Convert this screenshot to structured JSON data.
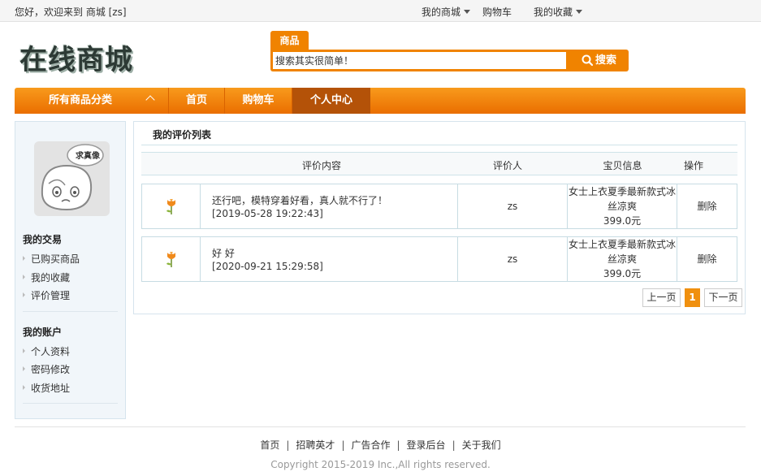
{
  "topbar": {
    "welcome": "您好，欢迎来到 商城 [zs]",
    "my_mall": "我的商城",
    "cart": "购物车",
    "favorites": "我的收藏"
  },
  "header": {
    "logo_text": "在线商城",
    "search_tab": "商品",
    "search_value": "搜索其实很简单！",
    "search_button": "搜索"
  },
  "nav": {
    "all_categories": "所有商品分类",
    "items": [
      "首页",
      "购物车",
      "个人中心"
    ],
    "active": "个人中心"
  },
  "sidebar": {
    "avatar_caption": "求真像",
    "section1_title": "我的交易",
    "section1_items": [
      "已购买商品",
      "我的收藏",
      "评价管理"
    ],
    "section2_title": "我的账户",
    "section2_items": [
      "个人资料",
      "密码修改",
      "收货地址"
    ]
  },
  "main": {
    "title": "我的评价列表",
    "columns": [
      "评价内容",
      "评价人",
      "宝贝信息",
      "操作"
    ],
    "rows": [
      {
        "comment": "还行吧，模特穿着好看，真人就不行了！",
        "date": "[2019-05-28 19:22:43]",
        "user": "zs",
        "product": "女士上衣夏季最新款式冰丝凉爽",
        "price": "399.0元",
        "action": "删除"
      },
      {
        "comment": "好 好",
        "date": "[2020-09-21 15:29:58]",
        "user": "zs",
        "product": "女士上衣夏季最新款式冰丝凉爽",
        "price": "399.0元",
        "action": "删除"
      }
    ],
    "pager": {
      "prev": "上一页",
      "current": "1",
      "next": "下一页"
    }
  },
  "footer": {
    "links": [
      "首页",
      "招聘英才",
      "广告合作",
      "登录后台",
      "关于我们"
    ],
    "copyright": "Copyright 2015-2019 Inc.,All rights reserved."
  },
  "colors": {
    "accent": "#f08300",
    "nav_active": "#b45208",
    "sidebar_bg": "#f1f6fa",
    "border": "#c7dce3"
  }
}
